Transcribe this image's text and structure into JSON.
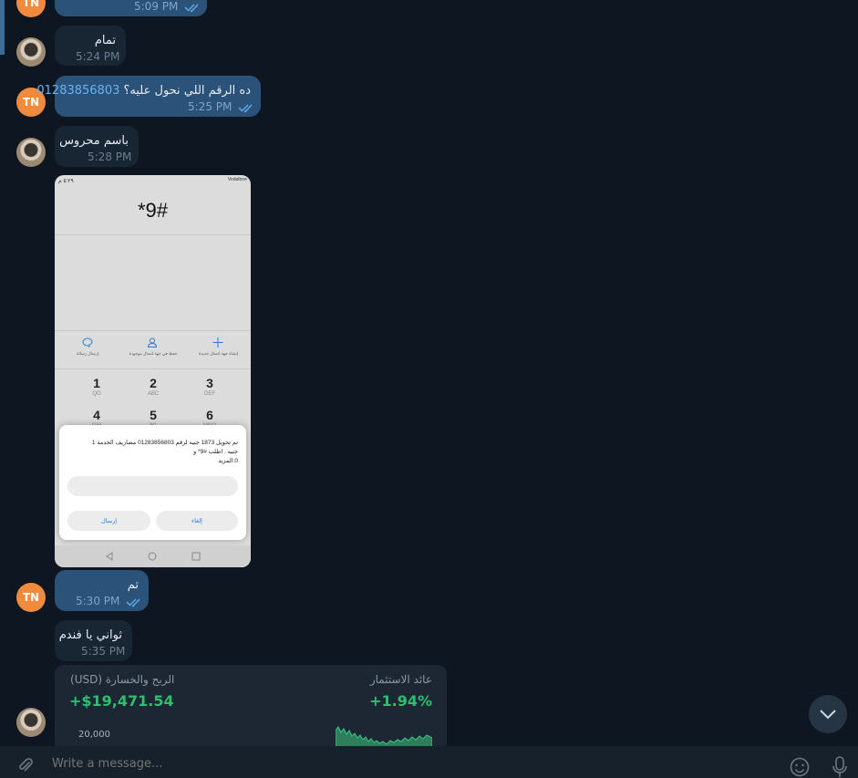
{
  "avatars": {
    "tn": "TN"
  },
  "messages": [
    {
      "dir": "out",
      "time": "5:09 PM"
    },
    {
      "dir": "in",
      "text": "تمام",
      "time": "5:24 PM"
    },
    {
      "dir": "out",
      "text": "ده الرقم اللي نحول عليه؟",
      "link": "01283856803",
      "time": "5:25 PM"
    },
    {
      "dir": "in",
      "text": "باسم محروس",
      "time": "5:28 PM"
    },
    {
      "dir": "out",
      "text": "تم",
      "time": "5:30 PM"
    },
    {
      "dir": "in",
      "text": "ثواني يا فندم",
      "time": "5:35 PM"
    }
  ],
  "phone": {
    "status_left": "٥:٢٩ م",
    "status_right": "Vodafone",
    "dialed": "*9#",
    "actions": [
      "إرسال رسالة",
      "حفظ في جهة اتصال موجودة",
      "إنشاء جهة اتصال جديدة"
    ],
    "keys": [
      {
        "d": "1",
        "s": "QO"
      },
      {
        "d": "2",
        "s": "ABC"
      },
      {
        "d": "3",
        "s": "DEF"
      },
      {
        "d": "4",
        "s": "GHI"
      },
      {
        "d": "5",
        "s": "JKL"
      },
      {
        "d": "6",
        "s": "MNO"
      }
    ],
    "dialog_text_1": "تم تحويل 1873 جنيه لرقم 01283856803 مصاريف الخدمة 1",
    "dialog_text_2": "جنيه . اطلب #9* و",
    "dialog_text_3": "0:المزيد",
    "send_label": "إرسال",
    "cancel_label": "إلغاء"
  },
  "investment_card": {
    "pnl_label": "الربح والخسارة (USD)",
    "pnl_value": "+$19,471.54",
    "return_label": "عائد الاستثمار",
    "return_value": "+1.94%",
    "axis_tick": "20,000",
    "accent": "#2fbf71"
  },
  "composer": {
    "placeholder": "Write a message..."
  },
  "colors": {
    "background": "#0e1621",
    "incoming": "#182533",
    "outgoing": "#2b5278",
    "avatar_tn": "#f08a3c"
  }
}
